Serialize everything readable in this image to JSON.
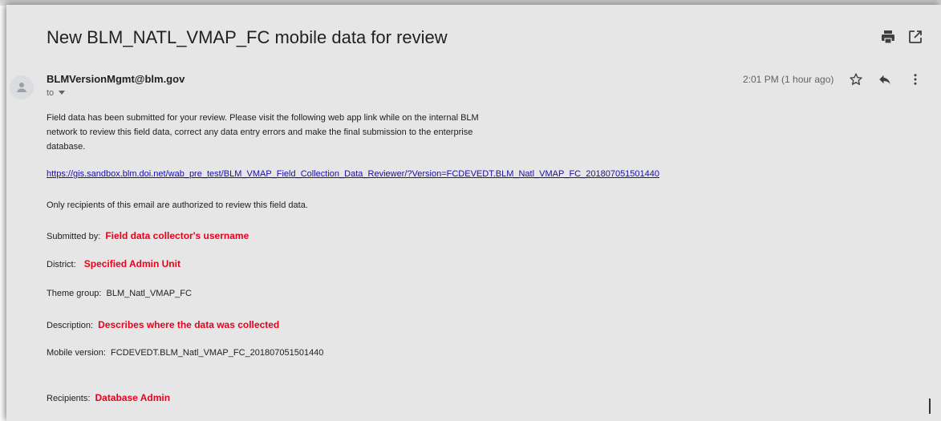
{
  "email": {
    "subject": "New BLM_NATL_VMAP_FC mobile data for review",
    "sender": "BLMVersionMgmt@blm.gov",
    "to_label": "to",
    "time": "2:01 PM (1 hour ago)",
    "body_intro": "Field data has been submitted for your review. Please visit the following web app link while on the internal BLM network to review this field data, correct any data entry errors and make the final submission to the enterprise database.",
    "link": "https://gis.sandbox.blm.doi.net/wab_pre_test/BLM_VMAP_Field_Collection_Data_Reviewer/?Version=FCDEVEDT.BLM_Natl_VMAP_FC_201807051501440",
    "authorized_note": "Only recipients of this email are authorized to review this field data.",
    "fields": {
      "submitted_by_label": "Submitted by:",
      "submitted_by_value": "Field data collector's username",
      "district_label": "District:",
      "district_value": "Specified Admin Unit",
      "theme_group_label": "Theme group:",
      "theme_group_value": "BLM_Natl_VMAP_FC",
      "description_label": "Description:",
      "description_value": "Describes where the data was collected",
      "mobile_version_label": "Mobile version:",
      "mobile_version_value": "FCDEVEDT.BLM_Natl_VMAP_FC_201807051501440",
      "recipients_label": "Recipients:",
      "recipients_value": "Database Admin"
    }
  },
  "icons": {
    "print": "print-icon",
    "open_new_window": "open-in-new-window-icon",
    "avatar": "person-icon",
    "star": "star-icon",
    "reply": "reply-icon",
    "more": "more-vertical-icon",
    "to_dropdown": "caret-down-icon"
  },
  "colors": {
    "background": "#e6e6e6",
    "link": "#1a0dab",
    "annotation_red": "#e8001c"
  }
}
